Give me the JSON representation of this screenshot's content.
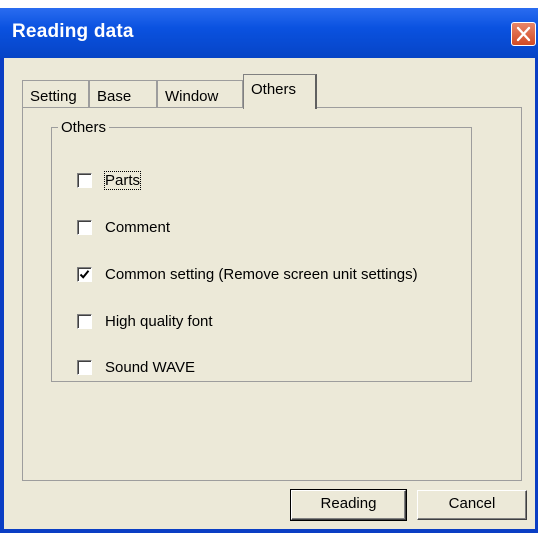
{
  "window": {
    "title": "Reading data"
  },
  "tabs": [
    {
      "label": "Setting",
      "active": false
    },
    {
      "label": "Base",
      "active": false
    },
    {
      "label": "Window",
      "active": false
    },
    {
      "label": "Others",
      "active": true
    }
  ],
  "group": {
    "label": "Others",
    "options": [
      {
        "label": "Parts",
        "checked": false
      },
      {
        "label": "Comment",
        "checked": false
      },
      {
        "label": "Common setting (Remove screen unit settings)",
        "checked": true
      },
      {
        "label": "High quality font",
        "checked": false
      },
      {
        "label": "Sound WAVE",
        "checked": false
      }
    ]
  },
  "buttons": {
    "reading": "Reading",
    "cancel": "Cancel"
  },
  "colors": {
    "titlebar": "#0a52e0",
    "close": "#d24a24",
    "face": "#ece9d8"
  }
}
